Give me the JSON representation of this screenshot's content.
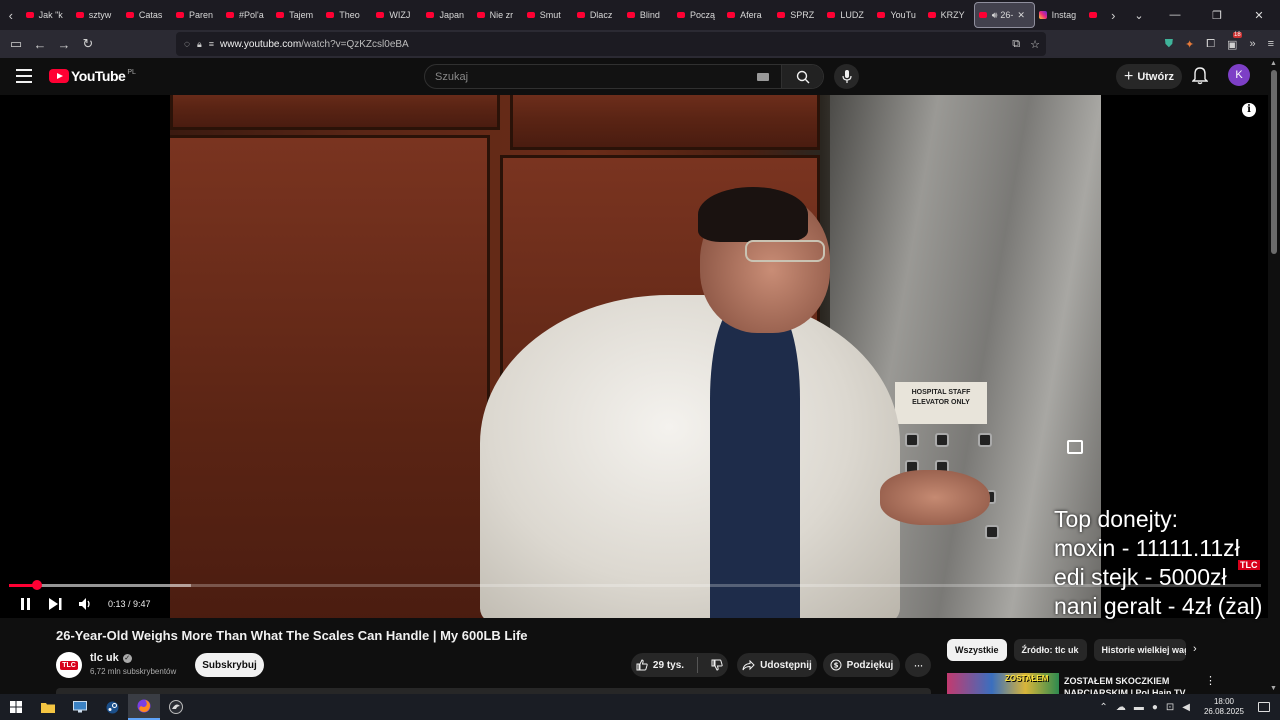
{
  "browser": {
    "tabs": [
      {
        "label": "Jak \"k",
        "icon": "youtube-icon"
      },
      {
        "label": "sztyw",
        "icon": "youtube-icon"
      },
      {
        "label": "Catas",
        "icon": "youtube-icon"
      },
      {
        "label": "Paren",
        "icon": "youtube-icon"
      },
      {
        "label": "#Pol'a",
        "icon": "youtube-icon"
      },
      {
        "label": "Tajem",
        "icon": "youtube-icon"
      },
      {
        "label": "Theo",
        "icon": "youtube-icon"
      },
      {
        "label": "WIZJ",
        "icon": "youtube-icon"
      },
      {
        "label": "Japan",
        "icon": "youtube-icon"
      },
      {
        "label": "Nie zr",
        "icon": "youtube-icon"
      },
      {
        "label": "Smut",
        "icon": "youtube-icon"
      },
      {
        "label": "Dlacz",
        "icon": "youtube-icon"
      },
      {
        "label": "Blind",
        "icon": "youtube-icon"
      },
      {
        "label": "Począ",
        "icon": "youtube-icon"
      },
      {
        "label": "Afera",
        "icon": "youtube-icon"
      },
      {
        "label": "SPRZ",
        "icon": "youtube-icon"
      },
      {
        "label": "LUDZ",
        "icon": "youtube-icon"
      },
      {
        "label": "YouTu",
        "icon": "youtube-icon"
      },
      {
        "label": "KRZY",
        "icon": "youtube-icon"
      }
    ],
    "active_tab": {
      "label": "26-",
      "icon": "youtube-icon"
    },
    "instagram_tab": {
      "label": "Instag",
      "icon": "instagram-icon"
    },
    "url_domain": "www.youtube.com",
    "url_path": "/watch?v=QzKZcsl0eBA",
    "extension_badge": "18"
  },
  "youtube": {
    "logo_text": "YouTube",
    "country_code": "PL",
    "search_placeholder": "Szukaj",
    "create_label": "Utwórz",
    "avatar_letter": "K",
    "accent_color": "#ff0033"
  },
  "player": {
    "current_time": "0:13",
    "duration": "9:47",
    "time_display": "0:13 / 9:47",
    "progress_fraction": 0.0221,
    "buffer_fraction": 0.145,
    "sign_text": [
      "HOSPITAL STAFF",
      "ELEVATOR ONLY"
    ],
    "watermark": "TLC",
    "donations_lines": [
      "Top donejty:",
      "moxin - 11111.11zł",
      "edi stejk - 5000zł",
      "nani geralt - 4zł (żal)"
    ]
  },
  "video": {
    "title": "26-Year-Old Weighs More Than What The Scales Can Handle | My 600LB Life",
    "channel_name": "tlc uk",
    "channel_avatar_text": "TLC",
    "subscribers": "6,72 mln subskrybentów",
    "subscribe_label": "Subskrybuj",
    "likes": "29 tys.",
    "share_label": "Udostępnij",
    "thanks_label": "Podziękuj"
  },
  "sidebar": {
    "chips": [
      "Wszystkie",
      "Źródło: tlc uk",
      "Historie wielkiej wag"
    ],
    "recommendation": {
      "title": "ZOSTAŁEM SKOCZKIEM NARCIARSKIM | Pol Hain TV",
      "thumb_text": "ZOSTAŁEM"
    }
  },
  "taskbar": {
    "time": "18:00",
    "date": "26.08.2025"
  }
}
